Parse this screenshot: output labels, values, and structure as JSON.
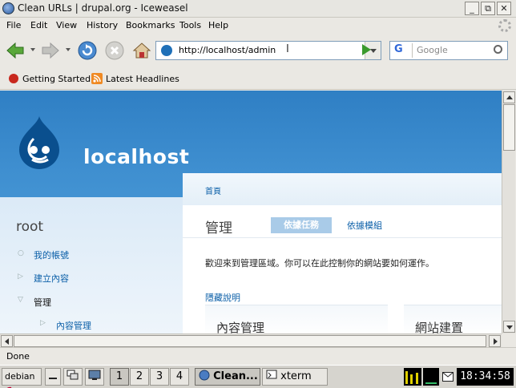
{
  "window": {
    "title": "Clean URLs | drupal.org - Iceweasel",
    "minimize": "_",
    "restore": "⧉",
    "close": "✕"
  },
  "menu": {
    "items": [
      "File",
      "Edit",
      "View",
      "History",
      "Bookmarks",
      "Tools",
      "Help"
    ]
  },
  "nav": {
    "url": "http://localhost/admin",
    "search_placeholder": "Google",
    "search_engine_letter": "G"
  },
  "bookmarks": {
    "items": [
      "Getting Started",
      "Latest Headlines"
    ]
  },
  "page": {
    "site_name": "localhost",
    "user": "root",
    "sidebar_items": [
      "我的帳號",
      "建立內容",
      "管理",
      "內容管理"
    ],
    "breadcrumb": "首頁",
    "title": "管理",
    "tab_active": "依據任務",
    "tab_other": "依據模組",
    "welcome": "歡迎來到管理區域。你可以在此控制你的網站要如何運作。",
    "hide_descriptions": "隱藏說明",
    "box_left_title": "內容管理",
    "box_right_title": "網站建置"
  },
  "status": {
    "text": "Done"
  },
  "taskbar": {
    "start": "debian",
    "workspaces": [
      "1",
      "2",
      "3",
      "4"
    ],
    "tasks": [
      "Clean...",
      "xterm"
    ],
    "clock": "18:34:58"
  },
  "colors": {
    "drupal_blue": "#2f7fc4",
    "link_blue": "#0b5fa8",
    "tab_active_bg": "#a9cbe8"
  }
}
